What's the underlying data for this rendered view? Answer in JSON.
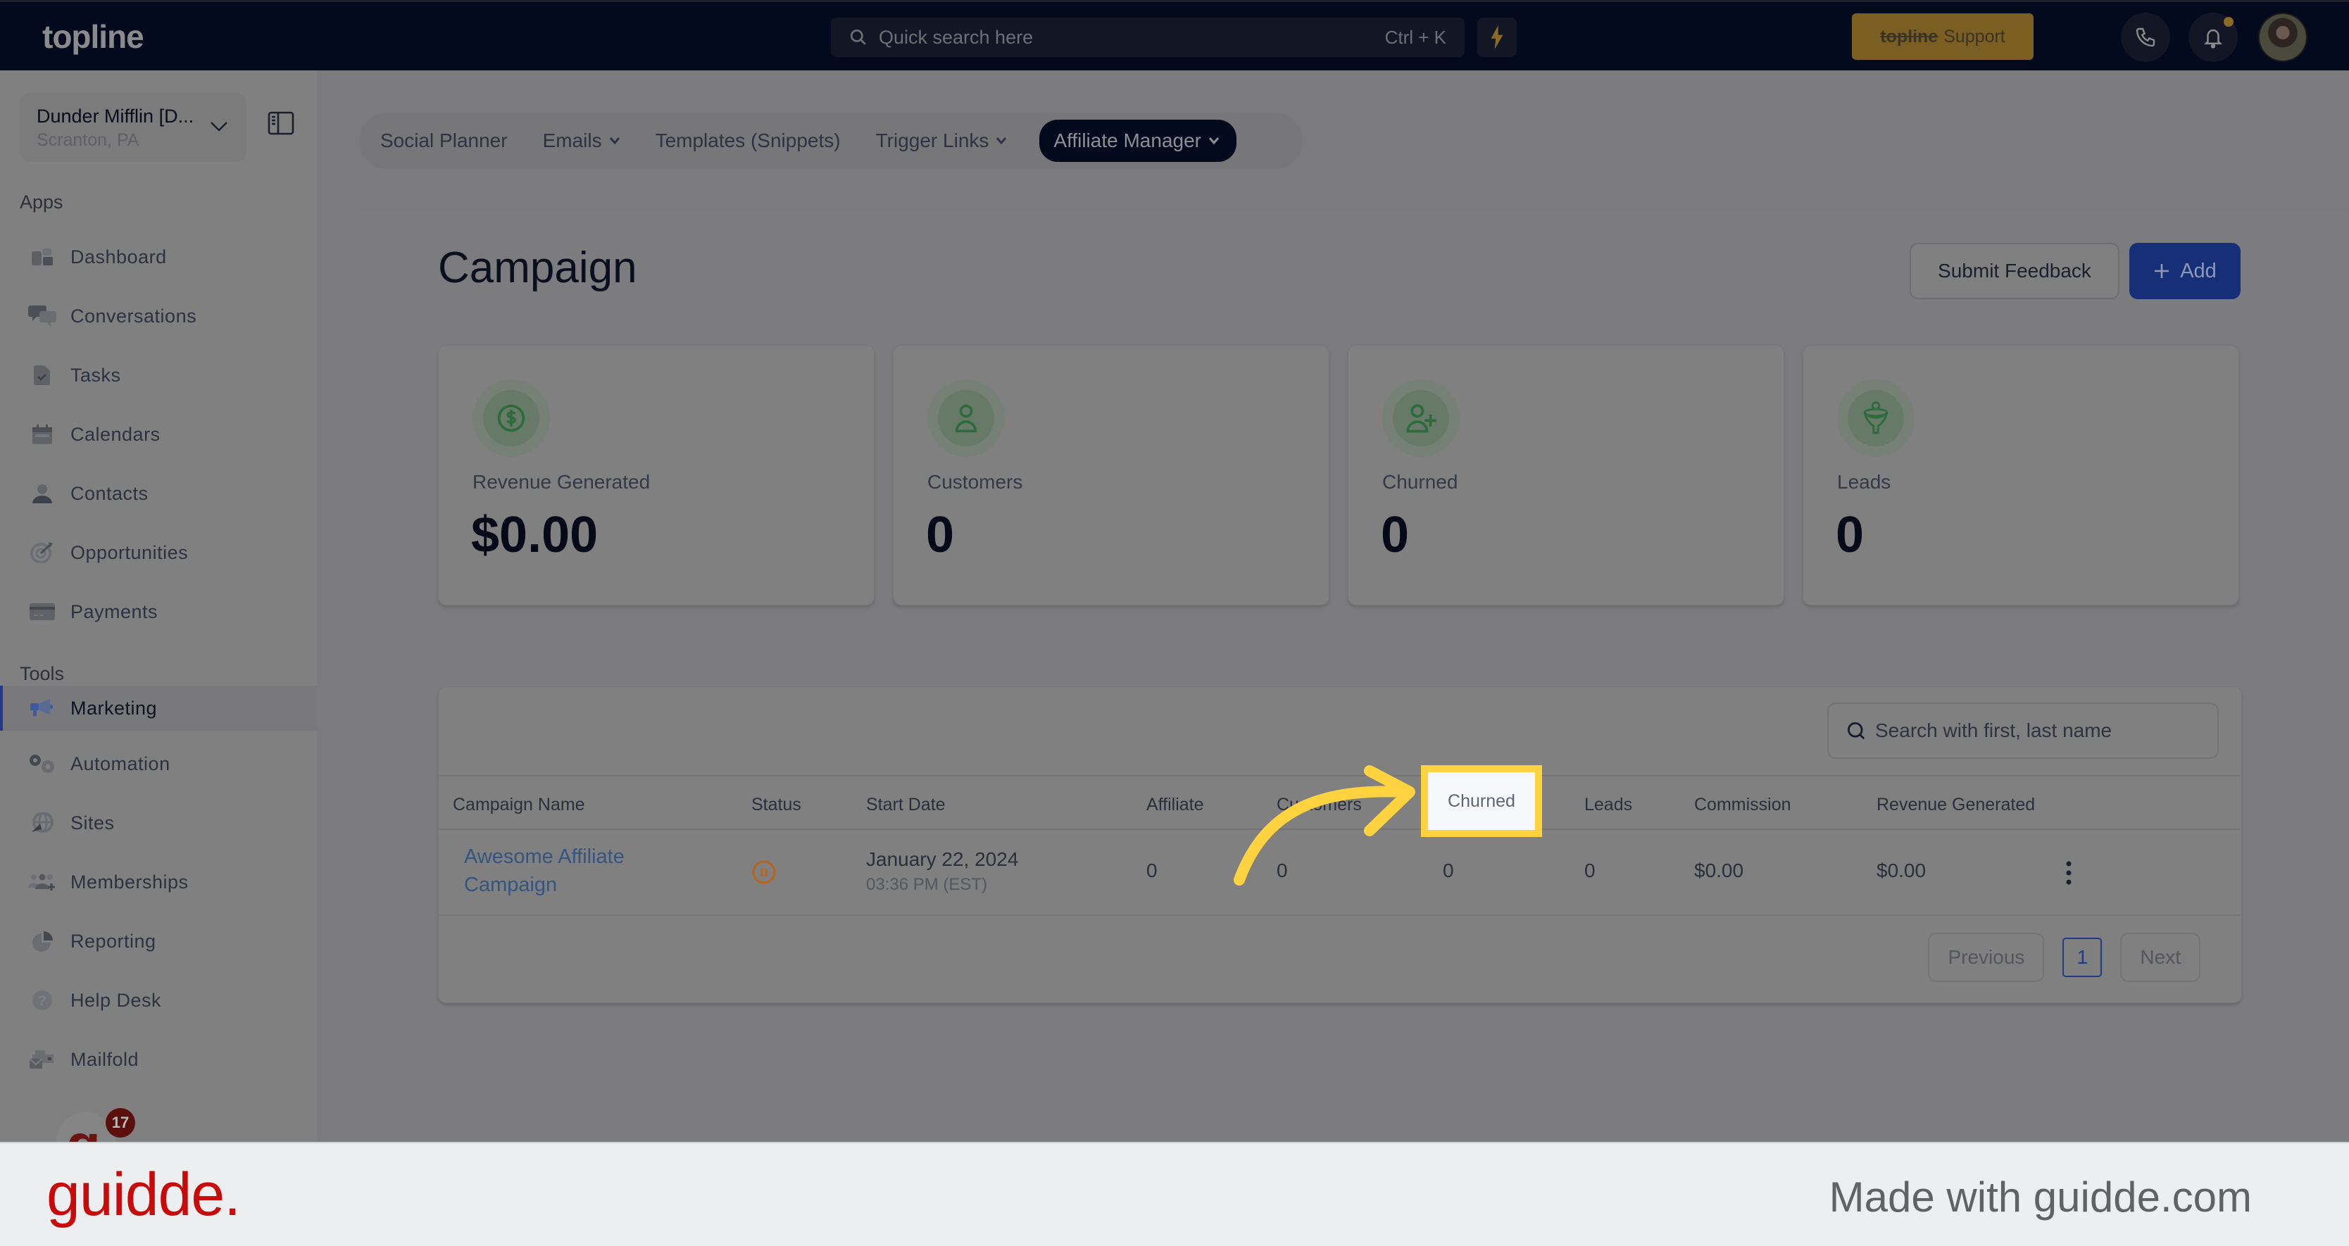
{
  "topbar": {
    "logo": "topline",
    "search_placeholder": "Quick search here",
    "search_shortcut": "Ctrl + K",
    "support_brand": "topline",
    "support_label": "Support",
    "notification_dot_color": "#8a6a25"
  },
  "sidebar": {
    "account": {
      "name": "Dunder Mifflin [D...",
      "location": "Scranton, PA"
    },
    "apps_label": "Apps",
    "apps": [
      {
        "label": "Dashboard",
        "icon": "dashboard-icon"
      },
      {
        "label": "Conversations",
        "icon": "chat-bubbles-icon"
      },
      {
        "label": "Tasks",
        "icon": "task-doc-icon"
      },
      {
        "label": "Calendars",
        "icon": "calendar-icon"
      },
      {
        "label": "Contacts",
        "icon": "person-icon"
      },
      {
        "label": "Opportunities",
        "icon": "target-icon"
      },
      {
        "label": "Payments",
        "icon": "credit-card-icon"
      }
    ],
    "tools_label": "Tools",
    "tools": [
      {
        "label": "Marketing",
        "icon": "megaphone-icon",
        "active": true
      },
      {
        "label": "Automation",
        "icon": "gears-icon"
      },
      {
        "label": "Sites",
        "icon": "globe-cursor-icon"
      },
      {
        "label": "Memberships",
        "icon": "users-plus-icon"
      },
      {
        "label": "Reporting",
        "icon": "pie-chart-icon"
      },
      {
        "label": "Help Desk",
        "icon": "question-icon"
      },
      {
        "label": "Mailfold",
        "icon": "mail-stack-icon"
      }
    ],
    "widget_badge": "17"
  },
  "tabs": [
    {
      "label": "Social Planner",
      "dropdown": false
    },
    {
      "label": "Emails",
      "dropdown": true
    },
    {
      "label": "Templates (Snippets)",
      "dropdown": false
    },
    {
      "label": "Trigger Links",
      "dropdown": true
    },
    {
      "label": "Affiliate Manager",
      "dropdown": true,
      "active": true
    }
  ],
  "page": {
    "title": "Campaign",
    "feedback_label": "Submit Feedback",
    "add_label": "Add"
  },
  "stats": [
    {
      "label": "Revenue Generated",
      "value": "$0.00",
      "icon": "dollar-circle-icon"
    },
    {
      "label": "Customers",
      "value": "0",
      "icon": "user-icon"
    },
    {
      "label": "Churned",
      "value": "0",
      "icon": "user-plus-icon"
    },
    {
      "label": "Leads",
      "value": "0",
      "icon": "funnel-icon"
    }
  ],
  "table": {
    "search_placeholder": "Search with first, last name",
    "columns": [
      "Campaign Name",
      "Status",
      "Start Date",
      "Affiliate",
      "Customers",
      "Churned",
      "Leads",
      "Commission",
      "Revenue Generated"
    ],
    "rows": [
      {
        "name_line1": "Awesome Affiliate",
        "name_line2": "Campaign",
        "status": "paused",
        "date": "January 22, 2024",
        "time": "03:36 PM (EST)",
        "affiliate": "0",
        "customers": "0",
        "churned": "0",
        "leads": "0",
        "commission": "$0.00",
        "revenue": "$0.00"
      }
    ],
    "pagination": {
      "previous": "Previous",
      "current": "1",
      "next": "Next"
    }
  },
  "highlight": {
    "label": "Churned",
    "color": "#ffd23f"
  },
  "footer": {
    "brand": "guidde.",
    "tagline": "Made with guidde.com"
  },
  "colors": {
    "accent": "#213a8a",
    "brand_red": "#c80a0a",
    "success": "#2e6b3c",
    "paused": "#b5651d"
  }
}
